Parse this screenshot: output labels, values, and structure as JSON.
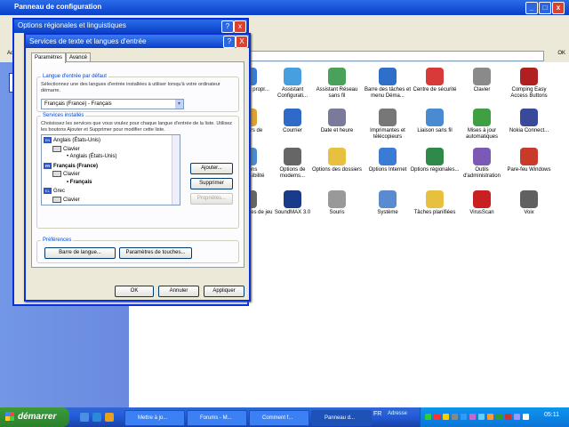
{
  "main_window": {
    "title": "Panneau de configuration",
    "address_label": "Adr",
    "go_label": "OK"
  },
  "icons": [
    {
      "label": "Affiche les propr...",
      "color": "#3a7bd5"
    },
    {
      "label": "Assistant Configurati...",
      "color": "#46a0e0"
    },
    {
      "label": "Assistant Réseau sans fil",
      "color": "#4aa25a"
    },
    {
      "label": "Barre des tâches et menu Déma...",
      "color": "#2e6fc7"
    },
    {
      "label": "Centre de sécurité",
      "color": "#d83a3a"
    },
    {
      "label": "Clavier",
      "color": "#8a8a8a"
    },
    {
      "label": "Comping Easy Access Buttons",
      "color": "#b02020"
    },
    {
      "label": "Couleurs de",
      "color": "#e0a030"
    },
    {
      "label": "Courrier",
      "color": "#2f6ac9"
    },
    {
      "label": "Date et heure",
      "color": "#7a7a9a"
    },
    {
      "label": "Imprimantes et télécopieurs",
      "color": "#777777"
    },
    {
      "label": "Liaison sans fil",
      "color": "#4a8ad0"
    },
    {
      "label": "Mises à jour automatiques",
      "color": "#3fa043"
    },
    {
      "label": "Nokia Connect...",
      "color": "#3a4a9a"
    },
    {
      "label": "Options d'accessibilité",
      "color": "#4a8ad0"
    },
    {
      "label": "Options de modems...",
      "color": "#666666"
    },
    {
      "label": "Options des dossiers",
      "color": "#e8c040"
    },
    {
      "label": "Options Internet",
      "color": "#3a7bd5"
    },
    {
      "label": "Options régionales...",
      "color": "#2f8a4a"
    },
    {
      "label": "Outils d'administration",
      "color": "#7a5ab5"
    },
    {
      "label": "Pare-feu Windows",
      "color": "#c83a2a"
    },
    {
      "label": "Périphériques de jeu",
      "color": "#666666"
    },
    {
      "label": "SoundMAX 3.0",
      "color": "#1a3a8a"
    },
    {
      "label": "Souris",
      "color": "#999999"
    },
    {
      "label": "Système",
      "color": "#5a8ad0"
    },
    {
      "label": "Tâches planifiées",
      "color": "#e8c040"
    },
    {
      "label": "VirusScan",
      "color": "#c82020"
    },
    {
      "label": "Voix",
      "color": "#606060"
    }
  ],
  "background_dialog": {
    "title": "Options régionales et linguistiques"
  },
  "dialog": {
    "title": "Services de texte et langues d'entrée",
    "help_btn": "?",
    "close_btn": "X",
    "tabs": [
      {
        "label": "Paramètres"
      },
      {
        "label": "Avancé"
      }
    ],
    "default_lang_group": {
      "label": "Langue d'entrée par défaut",
      "desc": "Sélectionnez une des langues d'entrée installées à utiliser lorsqu'à votre ordinateur démarre.",
      "value": "Français (France) - Français"
    },
    "installed_group": {
      "label": "Services installés",
      "desc": "Choisissez les services que vous voulez pour chaque langue d'entrée de la liste. Utilisez les boutons Ajouter et Supprimer pour modifier cette liste.",
      "tree": [
        {
          "kind": "lang",
          "flag": "EN",
          "text": "Anglais (États-Unis)",
          "bold": false
        },
        {
          "kind": "cat",
          "text": "Clavier"
        },
        {
          "kind": "item",
          "text": "Anglais (États-Unis)"
        },
        {
          "kind": "lang",
          "flag": "FR",
          "text": "Français (France)",
          "bold": true
        },
        {
          "kind": "cat",
          "text": "Clavier"
        },
        {
          "kind": "item",
          "text": "Français",
          "bold": true
        },
        {
          "kind": "lang",
          "flag": "EL",
          "text": "Grec",
          "bold": false
        },
        {
          "kind": "cat",
          "text": "Clavier"
        }
      ],
      "add_btn": "Ajouter...",
      "remove_btn": "Supprimer",
      "props_btn": "Propriétés..."
    },
    "prefs_group": {
      "label": "Préférences",
      "langbar_btn": "Barre de langue...",
      "keys_btn": "Paramètres de touches..."
    },
    "ok_btn": "OK",
    "cancel_btn": "Annuler",
    "apply_btn": "Appliquer"
  },
  "taskbar": {
    "start": "démarrer",
    "tasks": [
      {
        "label": "Mettre à jo...",
        "active": false
      },
      {
        "label": "Forums - M...",
        "active": false
      },
      {
        "label": "Comment f...",
        "active": false
      },
      {
        "label": "Panneau d...",
        "active": true
      }
    ],
    "lang": "FR",
    "address": "Adresse",
    "clock": "05:11"
  }
}
